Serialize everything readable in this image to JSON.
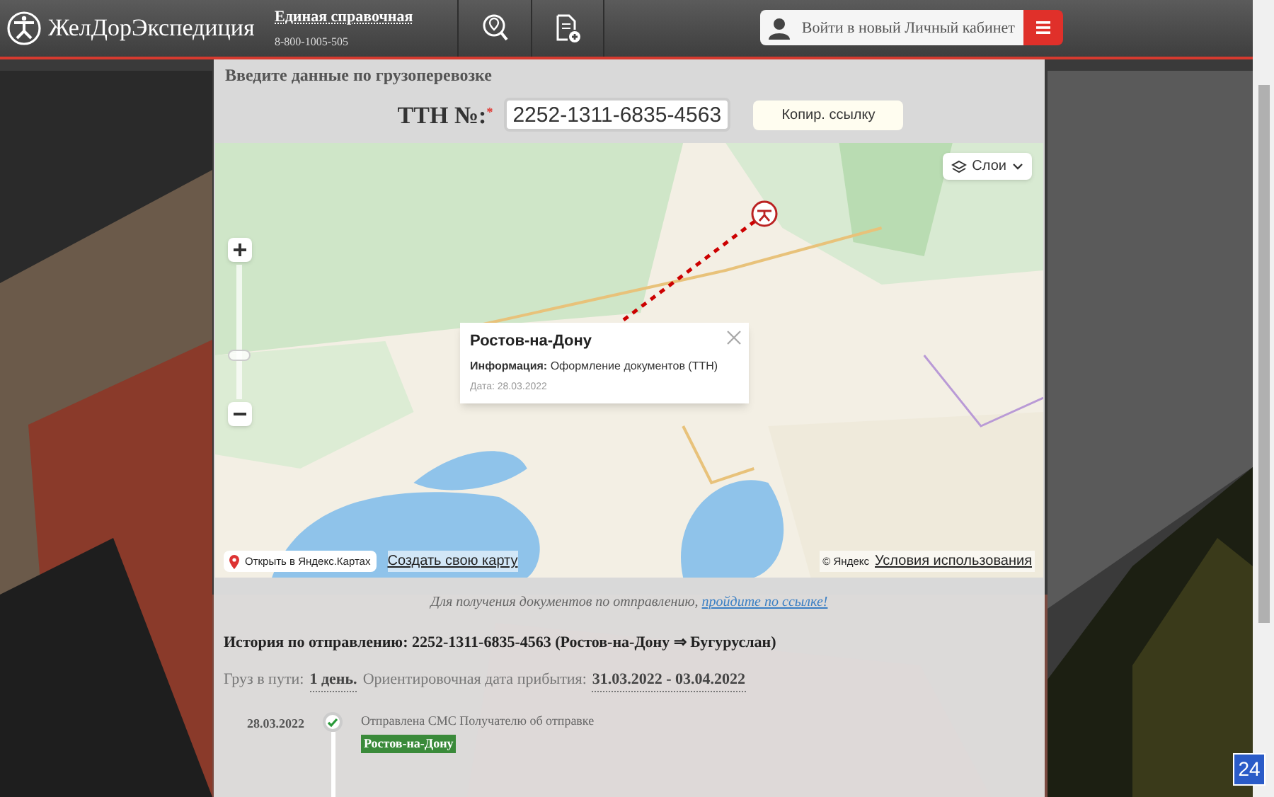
{
  "header": {
    "logo": "ЖелДорЭкспедиция",
    "hotline": {
      "label": "Единая справочная",
      "phone": "8-800-1005-505"
    },
    "login_button": "Войти в новый Личный кабинет"
  },
  "form": {
    "title": "Введите данные по грузоперевозке",
    "ttn_label": "ТТН №:",
    "required_mark": "*",
    "ttn_value": "2252-1311-6835-4563",
    "copy_button": "Копир. ссылку"
  },
  "map": {
    "kind": "picture",
    "layers_button": "Слои",
    "popup": {
      "title": "Ростов-на-Дону",
      "info_label": "Информация:",
      "info": "Оформление документов (ТТН)",
      "date": "Дата: 28.03.2022"
    },
    "open_link": "Открыть в Яндекс.Картах",
    "create_link": "Создать свою карту",
    "copyright": "© Яндекс",
    "terms_link": "Условия использования"
  },
  "docs_note": {
    "text": "Для получения документов по отправлению,",
    "link": "пройдите по ссылке!"
  },
  "history": {
    "title": "История по отправлению: 2252-1311-6835-4563 (Ростов-на-Дону ⇒ Бугуруслан)",
    "transit_label": "Груз в пути:",
    "transit_value": "1 день.",
    "eta_label": "Ориентировочная дата прибытия:",
    "eta_value": "31.03.2022 - 03.04.2022",
    "events": [
      {
        "date": "28.03.2022",
        "text": "Отправлена СМС Получателю об отправке",
        "place": "Ростов-на-Дону",
        "done": true
      }
    ]
  },
  "widget_badge": "24"
}
